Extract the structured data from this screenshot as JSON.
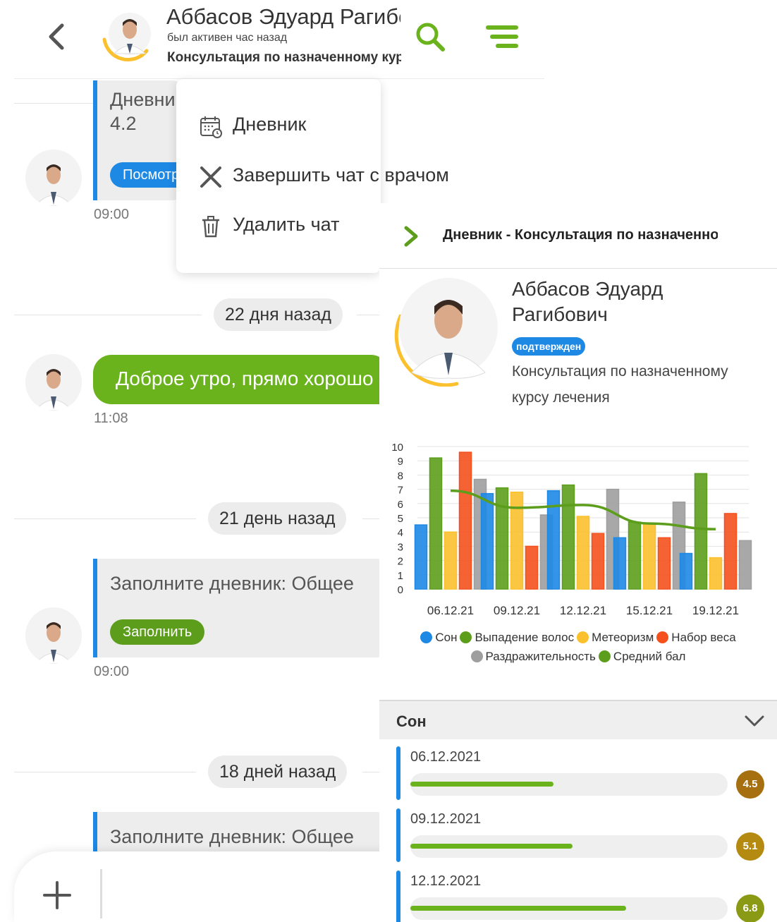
{
  "header": {
    "name": "Аббасов Эдуард Рагибович",
    "status": "был активен час назад",
    "subtitle": "Консультация по назначенному курсу лечения"
  },
  "menu": {
    "items": [
      {
        "label": "Дневник",
        "icon": "calendar-icon"
      },
      {
        "label": "Завершить чат с врачом",
        "icon": "close-icon"
      },
      {
        "label": "Удалить чат",
        "icon": "trash-icon"
      }
    ]
  },
  "chat": {
    "top_card": {
      "title": "Дневник",
      "value": "4.2",
      "button": "Посмотреть",
      "time": "09:00"
    },
    "date1": "22 дня назад",
    "message": {
      "text": "Доброе утро, прямо хорошо",
      "time": "11:08"
    },
    "date2": "21 день назад",
    "card2": {
      "text": "Заполните дневник: Общее",
      "button": "Заполнить",
      "time": "09:00"
    },
    "date3": "18 дней назад",
    "card3": {
      "text": "Заполните дневник: Общее"
    }
  },
  "panel": {
    "title": "Дневник - Консультация по назначенному курсу лечения",
    "doctor_name_line1": "Аббасов Эдуард",
    "doctor_name_line2": "Рагибович",
    "badge": "подтвержден",
    "course_line1": "Консультация по назначенному",
    "course_line2": "курсу лечения",
    "section_title": "Сон",
    "rows": [
      {
        "date": "06.12.2021",
        "score": "4.5",
        "value": 4.5,
        "score_color": "#a66f10"
      },
      {
        "date": "09.12.2021",
        "score": "5.1",
        "value": 5.1,
        "score_color": "#b48a10"
      },
      {
        "date": "12.12.2021",
        "score": "6.8",
        "value": 6.8,
        "score_color": "#8a9a14"
      }
    ]
  },
  "chart_data": {
    "type": "bar",
    "categories": [
      "06.12.21",
      "09.12.21",
      "12.12.21",
      "15.12.21",
      "19.12.21"
    ],
    "ylim": [
      0,
      10
    ],
    "yticks": [
      0,
      1,
      2,
      3,
      4,
      5,
      6,
      7,
      8,
      9,
      10
    ],
    "series": [
      {
        "name": "Сон",
        "color": "#1e88e5",
        "values": [
          4.5,
          6.7,
          6.9,
          3.6,
          2.5
        ]
      },
      {
        "name": "Выпадение волос",
        "color": "#5c9e1c",
        "values": [
          9.2,
          7.1,
          7.3,
          4.7,
          8.1
        ]
      },
      {
        "name": "Метеоризм",
        "color": "#fbc02d",
        "values": [
          4.0,
          6.8,
          5.1,
          4.6,
          2.2
        ]
      },
      {
        "name": "Набор веса",
        "color": "#f4511e",
        "values": [
          9.6,
          3.0,
          3.9,
          3.6,
          5.3
        ]
      },
      {
        "name": "Раздражительность",
        "color": "#9e9e9e",
        "values": [
          7.7,
          5.2,
          7.0,
          6.1,
          3.4
        ]
      }
    ],
    "line": {
      "name": "Средний бал",
      "color": "#5c9e1c",
      "values": [
        6.9,
        5.7,
        5.9,
        4.6,
        4.2
      ]
    }
  },
  "colors": {
    "accent_green": "#6ab31d",
    "accent_blue": "#1e88e5",
    "ring_yellow": "#fbc02d"
  }
}
